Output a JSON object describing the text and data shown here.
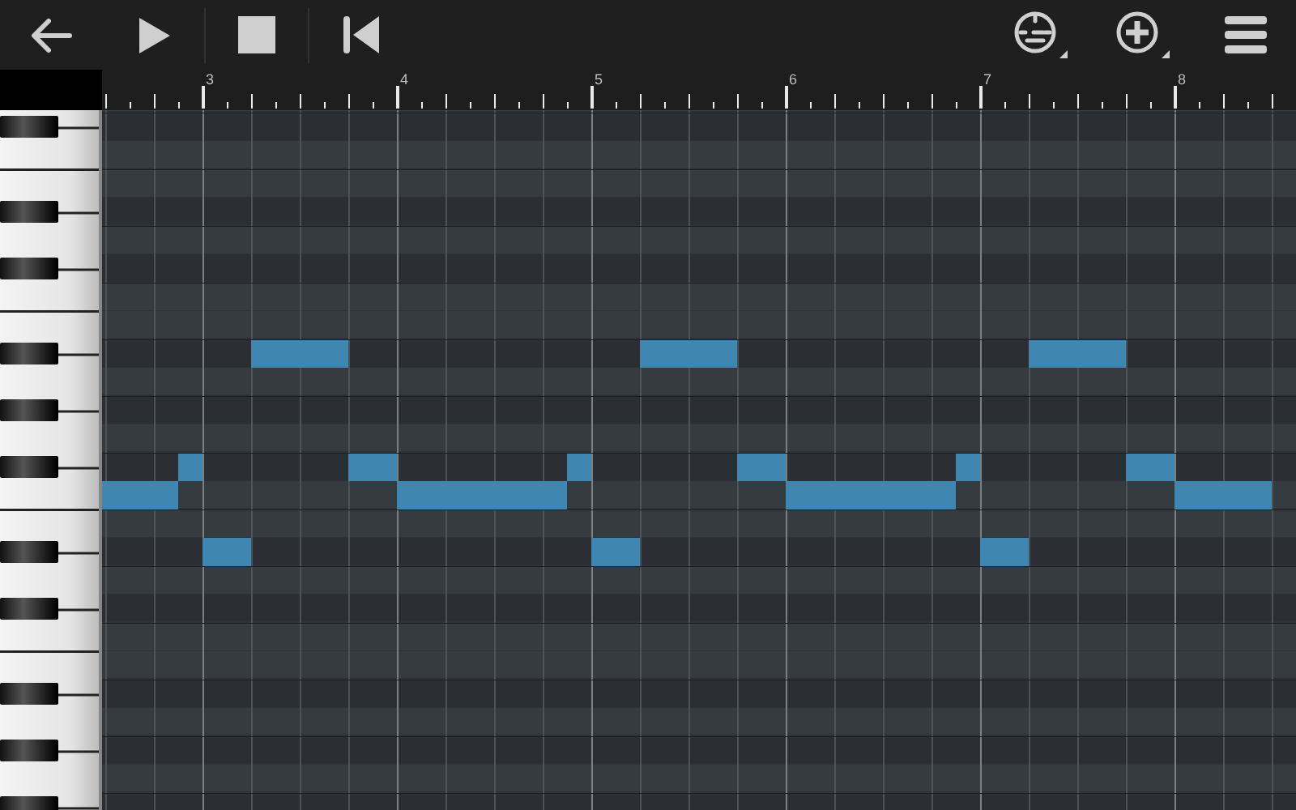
{
  "ruler": {
    "labels": [
      "3",
      "4",
      "5",
      "6",
      "7",
      "8"
    ]
  }
}
